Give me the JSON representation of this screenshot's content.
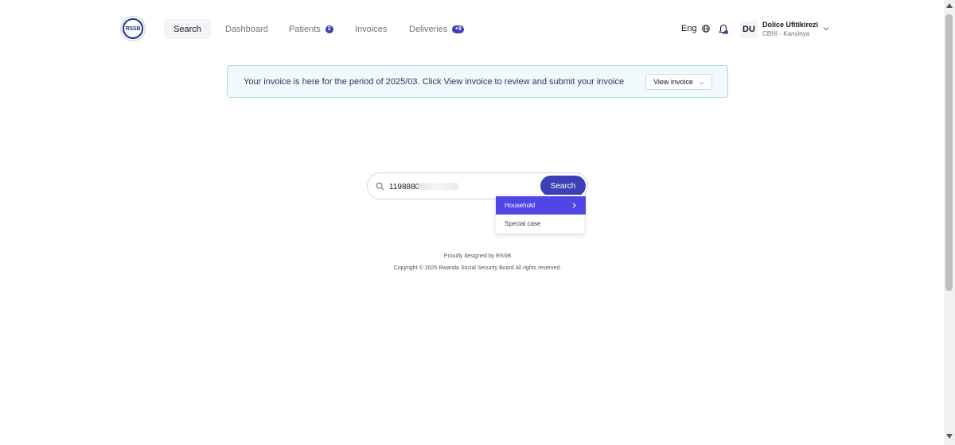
{
  "header": {
    "logo_text": "RSSB",
    "nav": [
      {
        "label": "Search",
        "active": true
      },
      {
        "label": "Dashboard",
        "active": false
      },
      {
        "label": "Patients",
        "active": false,
        "badge": "2"
      },
      {
        "label": "Invoices",
        "active": false
      },
      {
        "label": "Deliveries",
        "active": false,
        "badge": "+9"
      }
    ],
    "language": "Eng",
    "user": {
      "initials": "DU",
      "name": "Dolice Ufitikirezi",
      "subtitle": "CBHI - Kanyinya"
    }
  },
  "banner": {
    "message": "Your invoice is here for the period of 2025/03. Click View invoice to review and submit your invoice",
    "button_label": "View invoice"
  },
  "search": {
    "value": "1198880",
    "button_label": "Search",
    "dropdown": [
      {
        "label": "Household",
        "active": true
      },
      {
        "label": "Special case",
        "active": false
      }
    ]
  },
  "footer": {
    "line1": "Proudly designed by RSSB",
    "line2": "Copyright © 2025 Rwanda Social Security Board All rights reserved."
  },
  "colors": {
    "accent": "#3b3fb8",
    "dropdown_active": "#4f46e5",
    "banner_bg": "#f0f9fb",
    "banner_border": "#a5d8e6"
  }
}
